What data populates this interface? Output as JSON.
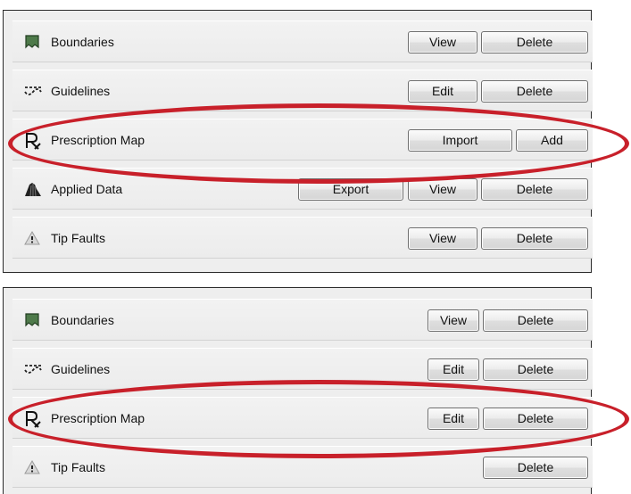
{
  "top_panel": {
    "rows": [
      {
        "label": "Boundaries",
        "icon": "boundary-icon",
        "buttons": [
          "View",
          "Delete"
        ]
      },
      {
        "label": "Guidelines",
        "icon": "guideline-icon",
        "buttons": [
          "Edit",
          "Delete"
        ]
      },
      {
        "label": "Prescription Map",
        "icon": "prescription-icon",
        "buttons": [
          "Import",
          "Add"
        ]
      },
      {
        "label": "Applied Data",
        "icon": "applied-data-icon",
        "buttons": [
          "Export",
          "View",
          "Delete"
        ]
      },
      {
        "label": "Tip Faults",
        "icon": "warning-icon",
        "buttons": [
          "View",
          "Delete"
        ]
      }
    ]
  },
  "bottom_panel": {
    "rows": [
      {
        "label": "Boundaries",
        "icon": "boundary-icon",
        "buttons": [
          "View",
          "Delete"
        ]
      },
      {
        "label": "Guidelines",
        "icon": "guideline-icon",
        "buttons": [
          "Edit",
          "Delete"
        ]
      },
      {
        "label": "Prescription Map",
        "icon": "prescription-icon",
        "buttons": [
          "Edit",
          "Delete"
        ]
      },
      {
        "label": "Tip Faults",
        "icon": "warning-icon",
        "buttons": [
          "Delete"
        ]
      }
    ]
  },
  "colors": {
    "highlight_oval": "#c8202a",
    "boundary_fill": "#4e7a4a",
    "panel_background": "#eeeeee"
  }
}
